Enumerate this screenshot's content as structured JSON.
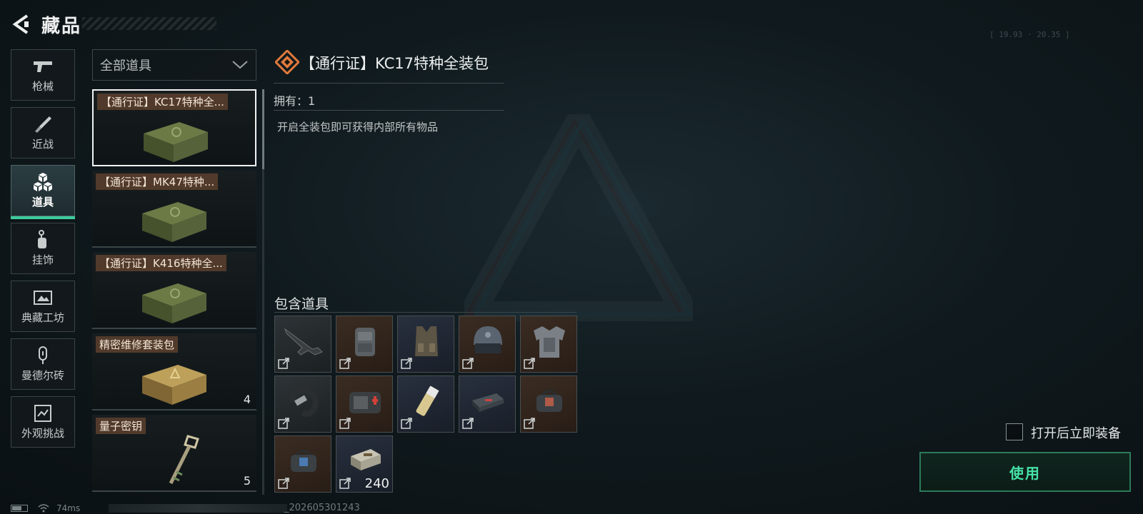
{
  "header": {
    "title": "藏品"
  },
  "sidebar": {
    "items": [
      {
        "label": "枪械",
        "icon": "gun-icon"
      },
      {
        "label": "近战",
        "icon": "knife-icon"
      },
      {
        "label": "道具",
        "icon": "cubes-icon",
        "active": true
      },
      {
        "label": "挂饰",
        "icon": "charm-icon"
      },
      {
        "label": "典藏工坊",
        "icon": "frame-icon"
      },
      {
        "label": "曼德尔砖",
        "icon": "brick-icon"
      },
      {
        "label": "外观挑战",
        "icon": "challenge-icon"
      }
    ]
  },
  "filter": {
    "selected": "全部道具"
  },
  "item_list": [
    {
      "name": "【通行证】KC17特种全...",
      "qty": "",
      "selected": true,
      "color": "#5c6a3c"
    },
    {
      "name": "【通行证】MK47特种...",
      "qty": "",
      "color": "#5c6a3c"
    },
    {
      "name": "【通行证】K416特种全...",
      "qty": "",
      "color": "#5c6a3c"
    },
    {
      "name": "精密维修套装包",
      "qty": "4",
      "color": "#a88a44"
    },
    {
      "name": "量子密钥",
      "qty": "5",
      "color": "#b0a27a"
    }
  ],
  "detail": {
    "title": "【通行证】KC17特种全装包",
    "owned": "拥有：1",
    "description": "开启全装包即可获得内部所有物品",
    "contains_title": "包含道具",
    "contents": [
      {
        "icon": "rifle-icon",
        "rarity": "gray",
        "count": ""
      },
      {
        "icon": "backpack-icon",
        "rarity": "brown",
        "count": ""
      },
      {
        "icon": "chest-rig-icon",
        "rarity": "blue",
        "count": ""
      },
      {
        "icon": "helmet-icon",
        "rarity": "brown",
        "count": ""
      },
      {
        "icon": "body-armor-icon",
        "rarity": "brown",
        "count": ""
      },
      {
        "icon": "tourniquet-icon",
        "rarity": "gray",
        "count": ""
      },
      {
        "icon": "medkit-icon",
        "rarity": "brown",
        "count": ""
      },
      {
        "icon": "injector-icon",
        "rarity": "blue",
        "count": ""
      },
      {
        "icon": "repair-kit-icon",
        "rarity": "blue",
        "count": ""
      },
      {
        "icon": "armor-repair-bag-icon",
        "rarity": "brown",
        "count": ""
      },
      {
        "icon": "helmet-repair-bag-icon",
        "rarity": "brown",
        "count": ""
      },
      {
        "icon": "ammo-box-icon",
        "rarity": "blue",
        "count": "240"
      }
    ]
  },
  "equip_option": {
    "label": "打开后立即装备",
    "checked": false
  },
  "use_button": {
    "label": "使用"
  },
  "status_bar": {
    "ping": "74ms",
    "build": "_202605301243"
  },
  "colors": {
    "accent": "#3dcb9c",
    "use_text": "#46e2a8",
    "tag_bg": "#583e2c",
    "title_icon": "#e07a3c"
  }
}
